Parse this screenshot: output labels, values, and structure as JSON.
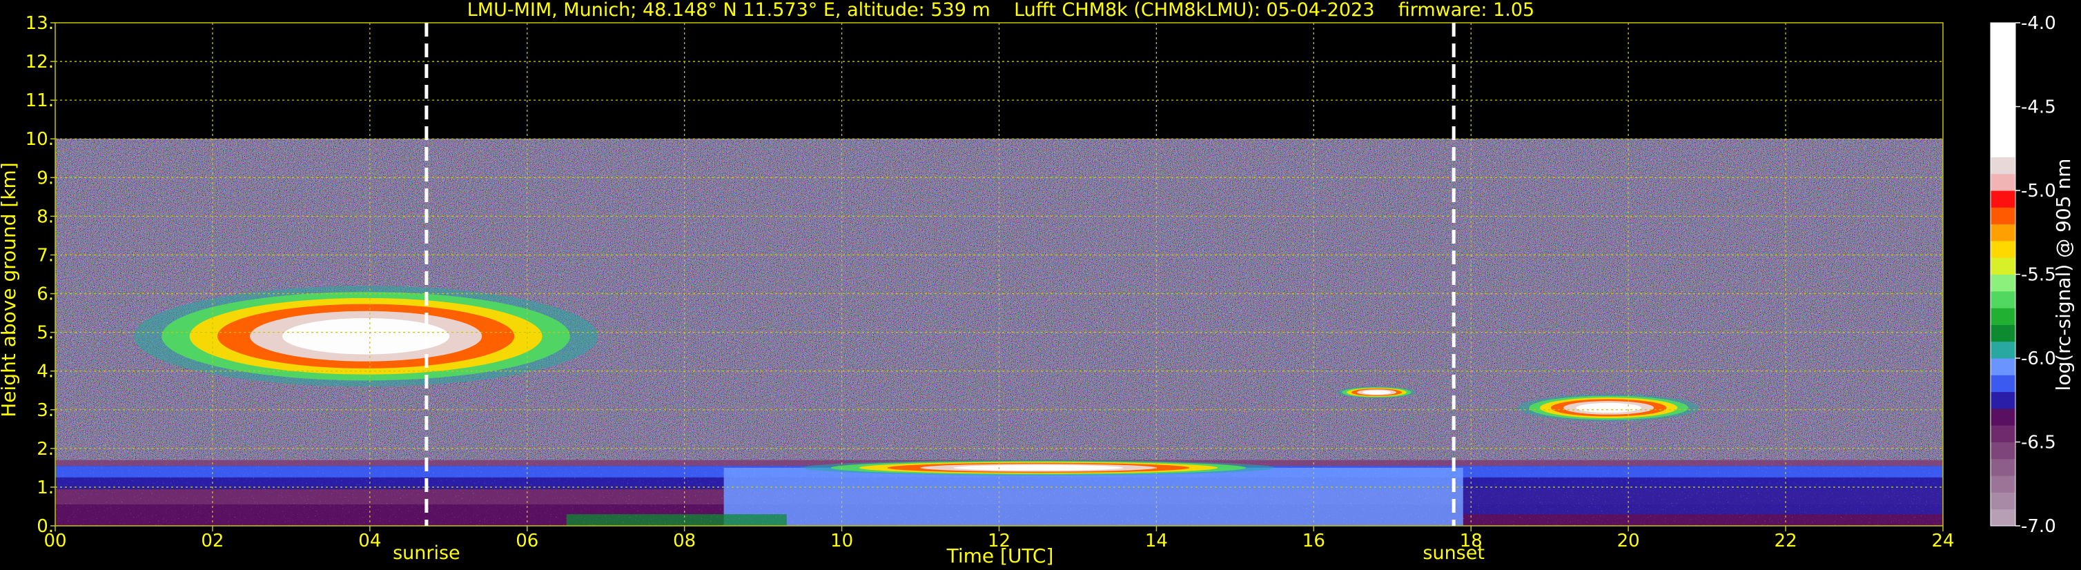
{
  "chart_data": {
    "type": "heatmap",
    "title": "LMU-MIM, Munich; 48.148° N 11.573° E, altitude: 539 m    Lufft CHM8k (CHM8kLMU): 05-04-2023    firmware: 1.05",
    "xlabel": "Time [UTC]",
    "ylabel": "Height above ground [km]",
    "xlim": [
      0,
      24
    ],
    "ylim": [
      0,
      13
    ],
    "x_ticks": [
      "00",
      "02",
      "04",
      "06",
      "08",
      "10",
      "12",
      "14",
      "16",
      "18",
      "20",
      "22",
      "24"
    ],
    "x_tick_values": [
      0,
      2,
      4,
      6,
      8,
      10,
      12,
      14,
      16,
      18,
      20,
      22,
      24
    ],
    "y_ticks": [
      "0.",
      "1.",
      "2.",
      "3.",
      "4.",
      "5.",
      "6.",
      "7.",
      "8.",
      "9.",
      "10.",
      "11.",
      "12.",
      "13."
    ],
    "y_tick_values": [
      0,
      1,
      2,
      3,
      4,
      5,
      6,
      7,
      8,
      9,
      10,
      11,
      12,
      13
    ],
    "grid": true,
    "grid_color": "#c8c800",
    "events": [
      {
        "label": "sunrise",
        "x": 4.72
      },
      {
        "label": "sunset",
        "x": 17.78
      }
    ],
    "data_ceiling_km": 10,
    "colorbar": {
      "label": "log(rc-signal) @ 905 nm",
      "range": [
        -7.0,
        -4.0
      ],
      "ticks": [
        "-4.0",
        "-4.5",
        "-5.0",
        "-5.5",
        "-6.0",
        "-6.5",
        "-7.0"
      ],
      "tick_values": [
        -4.0,
        -4.5,
        -5.0,
        -5.5,
        -6.0,
        -6.5,
        -7.0
      ],
      "colors": [
        {
          "from": -7.0,
          "to": -6.9,
          "color": "#b8a0b4"
        },
        {
          "from": -6.9,
          "to": -6.8,
          "color": "#a98aa6"
        },
        {
          "from": -6.8,
          "to": -6.7,
          "color": "#9c7498"
        },
        {
          "from": -6.7,
          "to": -6.6,
          "color": "#8e5e8a"
        },
        {
          "from": -6.6,
          "to": -6.5,
          "color": "#7e457b"
        },
        {
          "from": -6.5,
          "to": -6.4,
          "color": "#6e2a6c"
        },
        {
          "from": -6.4,
          "to": -6.3,
          "color": "#5a1060"
        },
        {
          "from": -6.3,
          "to": -6.2,
          "color": "#2a1ea8"
        },
        {
          "from": -6.2,
          "to": -6.1,
          "color": "#3a5af0"
        },
        {
          "from": -6.1,
          "to": -6.0,
          "color": "#6a94ff"
        },
        {
          "from": -6.0,
          "to": -5.9,
          "color": "#28a8a0"
        },
        {
          "from": -5.9,
          "to": -5.8,
          "color": "#0e8a30"
        },
        {
          "from": -5.8,
          "to": -5.7,
          "color": "#22b032"
        },
        {
          "from": -5.7,
          "to": -5.6,
          "color": "#50d860"
        },
        {
          "from": -5.6,
          "to": -5.5,
          "color": "#8cf07c"
        },
        {
          "from": -5.5,
          "to": -5.4,
          "color": "#d8f028"
        },
        {
          "from": -5.4,
          "to": -5.3,
          "color": "#ffd800"
        },
        {
          "from": -5.3,
          "to": -5.2,
          "color": "#ffa000"
        },
        {
          "from": -5.2,
          "to": -5.1,
          "color": "#ff5a00"
        },
        {
          "from": -5.1,
          "to": -5.0,
          "color": "#ff1010"
        },
        {
          "from": -5.0,
          "to": -4.9,
          "color": "#f0b4b4"
        },
        {
          "from": -4.9,
          "to": -4.8,
          "color": "#e8d8d8"
        },
        {
          "from": -4.8,
          "to": -4.0,
          "color": "#ffffff"
        }
      ]
    },
    "features": [
      {
        "kind": "cloud",
        "t_start": 1.0,
        "t_end": 6.9,
        "z_bottom": 3.6,
        "z_top": 6.2,
        "peak_log_signal": -4.0
      },
      {
        "kind": "cloud",
        "t_start": 16.3,
        "t_end": 17.3,
        "z_bottom": 3.3,
        "z_top": 3.6,
        "peak_log_signal": -4.0
      },
      {
        "kind": "cloud",
        "t_start": 18.6,
        "t_end": 20.9,
        "z_bottom": 2.7,
        "z_top": 3.4,
        "peak_log_signal": -4.0
      },
      {
        "kind": "low-cloud-tops",
        "t_start": 9.5,
        "t_end": 15.5,
        "z_bottom": 1.3,
        "z_top": 1.7,
        "peak_log_signal": -4.0
      },
      {
        "kind": "boundary-layer",
        "t_start": 0,
        "t_end": 24,
        "z_bottom": 0,
        "z_top": 1.7,
        "peak_log_signal": -6.3
      },
      {
        "kind": "background-noise",
        "t_start": 0,
        "t_end": 24,
        "z_bottom": 1.7,
        "z_top": 10,
        "peak_log_signal": -6.5
      }
    ]
  }
}
